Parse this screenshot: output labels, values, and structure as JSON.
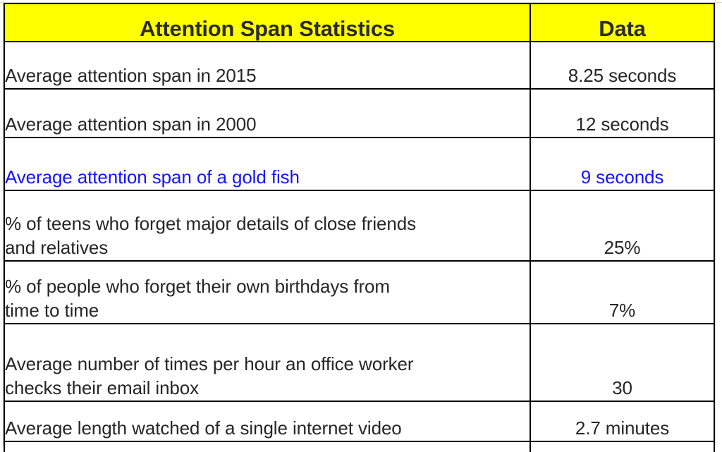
{
  "table": {
    "headers": {
      "label_column": "Attention Span Statistics",
      "data_column": "Data"
    },
    "header_background": "#FFFF00",
    "highlight_color": "#1414FF",
    "rows": [
      {
        "label": "Average attention span in 2015",
        "label_lines": [
          "Average attention span in 2015"
        ],
        "value": "8.25 seconds",
        "highlighted": false
      },
      {
        "label": "Average attention span in 2000",
        "label_lines": [
          "Average attention span in 2000"
        ],
        "value": "12 seconds",
        "highlighted": false
      },
      {
        "label": "Average attention span of a gold fish",
        "label_lines": [
          "Average attention span of a gold fish"
        ],
        "value": "9 seconds",
        "highlighted": true
      },
      {
        "label": "% of teens who forget major details of close friends and relatives",
        "label_lines": [
          "% of teens who forget major details of close friends",
          "and relatives"
        ],
        "value": "25%",
        "highlighted": false
      },
      {
        "label": "% of people who forget their own birthdays from time to time",
        "label_lines": [
          "% of people who forget their own birthdays from",
          "time to time"
        ],
        "value": "7%",
        "highlighted": false
      },
      {
        "label": "Average number of times per hour an office worker checks their email inbox",
        "label_lines": [
          "Average number of times per hour an office worker",
          "checks their email inbox"
        ],
        "value": "30",
        "highlighted": false
      },
      {
        "label": "Average length watched of a single internet video",
        "label_lines": [
          "Average length watched of a single internet video"
        ],
        "value": "2.7 minutes",
        "highlighted": false
      }
    ]
  }
}
